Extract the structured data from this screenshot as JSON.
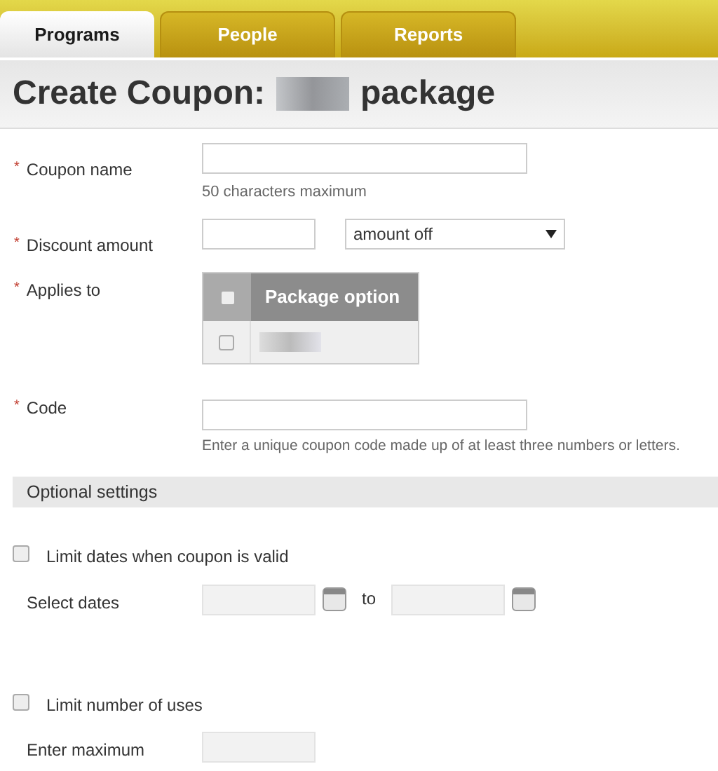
{
  "tabs": [
    {
      "label": "Programs",
      "selected": true
    },
    {
      "label": "People",
      "selected": false
    },
    {
      "label": "Reports",
      "selected": false
    }
  ],
  "page_title": {
    "prefix": "Create Coupon:",
    "suffix": "package"
  },
  "form": {
    "coupon_name": {
      "label": "Coupon name",
      "required_mark": "*",
      "hint": "50 characters maximum"
    },
    "discount_amount": {
      "label": "Discount amount",
      "required_mark": "*",
      "type_value": "amount off"
    },
    "applies_to": {
      "label": "Applies to",
      "required_mark": "*",
      "header": "Package option",
      "header_checked": false,
      "rows": [
        {
          "checked": false
        }
      ]
    },
    "code": {
      "label": "Code",
      "required_mark": "*",
      "hint": "Enter a unique coupon code made up of at least three numbers or letters."
    }
  },
  "optional_settings": {
    "title": "Optional settings",
    "limit_dates": {
      "label": "Limit dates when coupon is valid",
      "checked": false,
      "select_label": "Select dates",
      "to_label": "to"
    },
    "limit_uses": {
      "label": "Limit number of uses",
      "checked": false,
      "max_label": "Enter maximum"
    }
  }
}
